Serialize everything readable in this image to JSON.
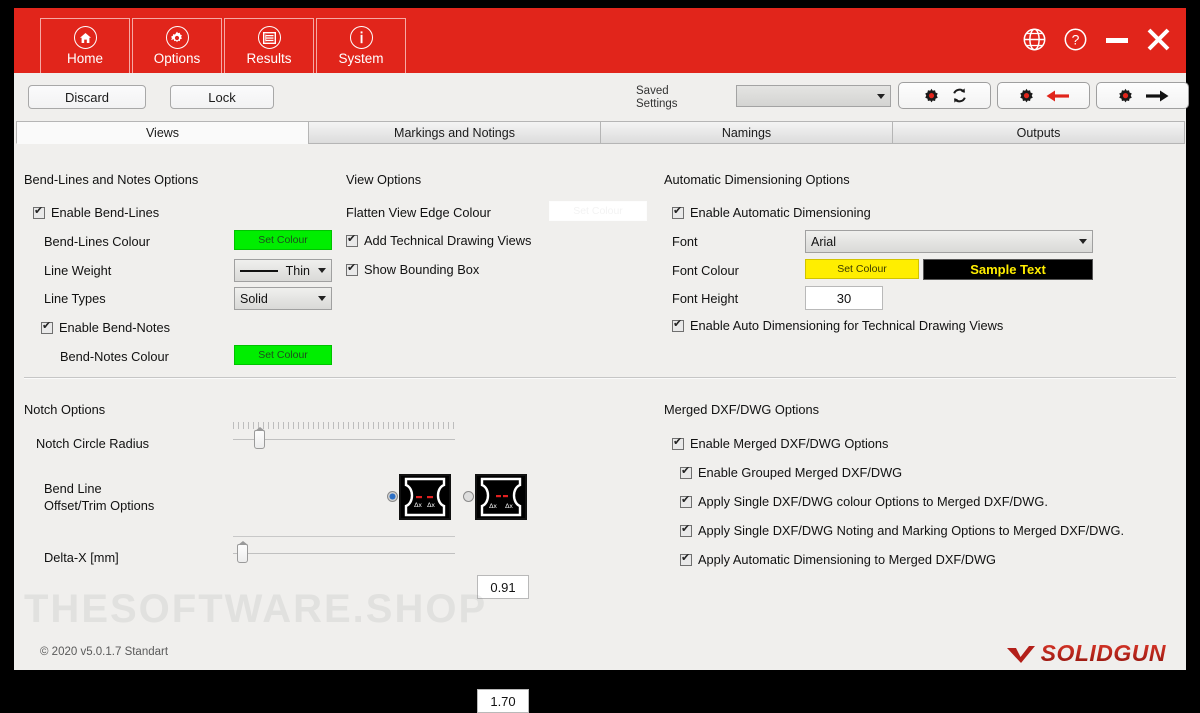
{
  "ribbon": {
    "tabs": [
      {
        "label": "Home",
        "icon": "home-icon"
      },
      {
        "label": "Options",
        "icon": "gear-icon"
      },
      {
        "label": "Results",
        "icon": "list-icon"
      },
      {
        "label": "System",
        "icon": "info-icon"
      }
    ],
    "window_controls": [
      {
        "name": "language-globe-icon"
      },
      {
        "name": "help-question-icon"
      },
      {
        "name": "minimize-icon"
      },
      {
        "name": "close-icon"
      }
    ],
    "accent_color": "#e1251b"
  },
  "toolbar": {
    "discard_label": "Discard",
    "lock_label": "Lock",
    "saved_settings_label_line1": "Saved",
    "saved_settings_label_line2": "Settings",
    "saved_settings_value": "",
    "gear_refresh_label": "",
    "gear_back_label": "",
    "gear_forward_label": ""
  },
  "tabs": [
    {
      "label": "Views",
      "active": true
    },
    {
      "label": "Markings and Notings",
      "active": false
    },
    {
      "label": "Namings",
      "active": false
    },
    {
      "label": "Outputs",
      "active": false
    }
  ],
  "bend_lines": {
    "group_title": "Bend-Lines and Notes Options",
    "enable_bend_lines": "Enable Bend-Lines",
    "bend_lines_colour_label": "Bend-Lines Colour",
    "bend_lines_colour_btn": "Set Colour",
    "bend_lines_colour_value": "#00ee00",
    "line_weight_label": "Line Weight",
    "line_weight_value": "Thin",
    "line_types_label": "Line Types",
    "line_types_value": "Solid",
    "enable_bend_notes": "Enable Bend-Notes",
    "bend_notes_colour_label": "Bend-Notes Colour",
    "bend_notes_colour_btn": "Set Colour",
    "bend_notes_colour_value": "#00ee00"
  },
  "view_options": {
    "group_title": "View Options",
    "flatten_edge_colour_label": "Flatten View Edge Colour",
    "flatten_edge_colour_btn": "Set Colour",
    "flatten_edge_colour_value": "#ffffff",
    "add_technical_drawing_views": "Add Technical Drawing Views",
    "show_bounding_box": "Show Bounding Box"
  },
  "auto_dim": {
    "group_title": "Automatic Dimensioning Options",
    "enable_label": "Enable Automatic Dimensioning",
    "font_label": "Font",
    "font_value": "Arial",
    "font_colour_label": "Font Colour",
    "font_colour_btn": "Set Colour",
    "font_colour_value": "#ffee00",
    "sample_text": "Sample Text",
    "sample_bg": "#000000",
    "font_height_label": "Font Height",
    "font_height_value": "30",
    "enable_tech_views_label": "Enable Auto Dimensioning for Technical Drawing Views"
  },
  "notch": {
    "group_title": "Notch Options",
    "radius_label": "Notch Circle Radius",
    "radius_value": "0.91",
    "radius_slider_pct": 10,
    "bend_line_label_line1": "Bend Line",
    "bend_line_label_line2": "Offset/Trim Options",
    "option1_selected": true,
    "option2_selected": false,
    "option_glyph_label": "Δx",
    "delta_x_label": "Delta-X [mm]",
    "delta_x_value": "1.70",
    "delta_x_slider_pct": 2
  },
  "merged": {
    "group_title": "Merged DXF/DWG Options",
    "items": [
      "Enable Merged DXF/DWG Options",
      "Enable Grouped Merged DXF/DWG",
      "Apply Single DXF/DWG colour Options to Merged DXF/DWG.",
      "Apply Single DXF/DWG Noting and Marking Options to Merged DXF/DWG.",
      "Apply Automatic Dimensioning to Merged DXF/DWG"
    ]
  },
  "footer": {
    "version": "2020 v5.0.1.7 Standart",
    "logo_text": "SOLIDGUN",
    "watermark": "THESOFTWARE.SHOP"
  }
}
